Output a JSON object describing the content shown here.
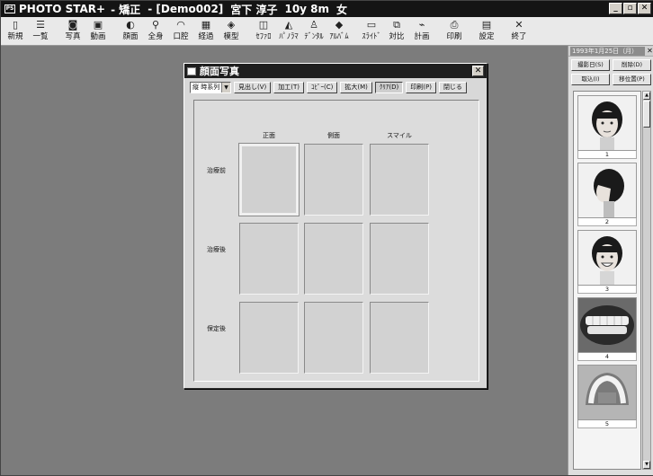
{
  "window": {
    "app_name": "PHOTO STAR+",
    "title_parts": [
      "- 矯正",
      "- [Demo002]",
      "宮下 淳子",
      "10y 8m",
      "女"
    ],
    "controls": [
      "_",
      "▫",
      "✕"
    ]
  },
  "toolbar": {
    "buttons": [
      {
        "label": "新規",
        "icon": "new-doc-icon",
        "glyph": "▯"
      },
      {
        "label": "一覧",
        "icon": "list-icon",
        "glyph": "☰"
      },
      {
        "label": "写真",
        "icon": "camera-icon",
        "glyph": "◙"
      },
      {
        "label": "動画",
        "icon": "video-icon",
        "glyph": "▣"
      },
      {
        "label": "顔面",
        "icon": "face-icon",
        "glyph": "◐"
      },
      {
        "label": "全身",
        "icon": "body-icon",
        "glyph": "⚲"
      },
      {
        "label": "口腔",
        "icon": "mouth-icon",
        "glyph": "◠"
      },
      {
        "label": "経過",
        "icon": "progress-icon",
        "glyph": "▦"
      },
      {
        "label": "模型",
        "icon": "model-icon",
        "glyph": "◈"
      },
      {
        "label": "ｾﾌｧﾛ",
        "icon": "cephalo-icon",
        "glyph": "◫"
      },
      {
        "label": "ﾊﾟﾉﾗﾏ",
        "icon": "panorama-icon",
        "glyph": "◭"
      },
      {
        "label": "ﾃﾞﾝﾀﾙ",
        "icon": "dental-icon",
        "glyph": "♙"
      },
      {
        "label": "ｱﾙﾊﾞﾑ",
        "icon": "album-icon",
        "glyph": "◆"
      },
      {
        "label": "ｽﾗｲﾄﾞ",
        "icon": "slide-icon",
        "glyph": "▭"
      },
      {
        "label": "対比",
        "icon": "compare-icon",
        "glyph": "⧉"
      },
      {
        "label": "計画",
        "icon": "plan-icon",
        "glyph": "⌁"
      },
      {
        "label": "印刷",
        "icon": "printer-icon",
        "glyph": "⎙"
      },
      {
        "label": "設定",
        "icon": "settings-icon",
        "glyph": "▤"
      },
      {
        "label": "終了",
        "icon": "exit-icon",
        "glyph": "✕"
      }
    ]
  },
  "dialog": {
    "title": "顔面写真",
    "close": "✕",
    "select_value": "縦 時系列",
    "buttons": [
      {
        "label": "見出し(V)",
        "pressed": false
      },
      {
        "label": "加工(T)",
        "pressed": false
      },
      {
        "label": "ｺﾋﾟｰ(C)",
        "pressed": false
      },
      {
        "label": "拡大(M)",
        "pressed": false
      },
      {
        "label": "ｸﾘｱ(D)",
        "pressed": true
      },
      {
        "label": "印刷(P)",
        "pressed": false
      },
      {
        "label": "閉じる",
        "pressed": false
      }
    ],
    "columns": [
      "正面",
      "側面",
      "スマイル"
    ],
    "rows": [
      "治療前",
      "治療後",
      "保定後"
    ]
  },
  "right_panel": {
    "date": "1993年1月25日（月）",
    "close": "✕",
    "buttons_row1": [
      "撮影日(S)",
      "削除(D)"
    ],
    "buttons_row2": [
      "取込(I)",
      "移位置(P)"
    ],
    "thumbnails": [
      {
        "label": "1",
        "kind": "face-front"
      },
      {
        "label": "2",
        "kind": "face-side"
      },
      {
        "label": "3",
        "kind": "face-smile"
      },
      {
        "label": "4",
        "kind": "teeth-front"
      },
      {
        "label": "5",
        "kind": "teeth-upper"
      }
    ]
  }
}
